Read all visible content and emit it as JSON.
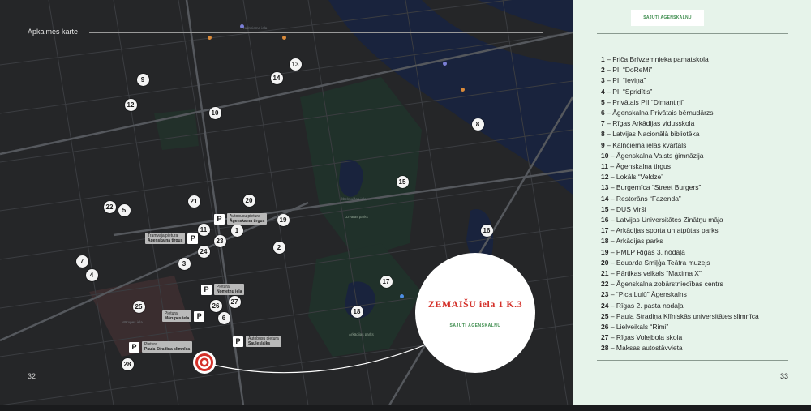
{
  "header": {
    "title": "Apkaimes karte",
    "page_left": "32",
    "page_right": "33"
  },
  "brand": "SAJŪTI ĀGENSKALNU",
  "callout": {
    "title": "ZEMAIŠU iela 1 K.3",
    "brand": "SAJŪTI ĀGENSKALNU"
  },
  "colors": {
    "accent_red": "#d4312a",
    "brand_green": "#3e8d4e",
    "panel_bg": "#e6f3ea",
    "map_bg": "#252628",
    "water": "#19233d",
    "park": "#20312a"
  },
  "map_markers": [
    {
      "num": "1"
    },
    {
      "num": "2"
    },
    {
      "num": "3"
    },
    {
      "num": "4"
    },
    {
      "num": "5"
    },
    {
      "num": "6"
    },
    {
      "num": "7"
    },
    {
      "num": "8"
    },
    {
      "num": "9"
    },
    {
      "num": "10"
    },
    {
      "num": "11"
    },
    {
      "num": "12"
    },
    {
      "num": "13"
    },
    {
      "num": "14"
    },
    {
      "num": "15"
    },
    {
      "num": "16"
    },
    {
      "num": "17"
    },
    {
      "num": "18"
    },
    {
      "num": "19"
    },
    {
      "num": "20"
    },
    {
      "num": "21"
    },
    {
      "num": "22"
    },
    {
      "num": "23"
    },
    {
      "num": "24"
    },
    {
      "num": "25"
    },
    {
      "num": "26"
    },
    {
      "num": "27"
    },
    {
      "num": "28"
    }
  ],
  "parking": [
    {
      "badge": "P",
      "line1": "Autobusu pietura",
      "line2": "Āgenskalna tirgus"
    },
    {
      "badge": "P",
      "line1": "Tramvaja pietura",
      "line2": "Āgenskalna tirgus"
    },
    {
      "badge": "P",
      "line1": "Pietura",
      "line2": "Nometņu iela"
    },
    {
      "badge": "P",
      "line1": "Pietura",
      "line2": "Mārupes iela"
    },
    {
      "badge": "P",
      "line1": "Autobusu pietura",
      "line2": "Sauleslaiks"
    },
    {
      "badge": "P",
      "line1": "Pietura",
      "line2": "Paula Stradiņa slimnīca"
    }
  ],
  "map_labels": {
    "street1": "Kalnciema iela",
    "street2": "Mārupes iela",
    "street3": "Ēbelmuižas iela",
    "park": "Arkādijas parks",
    "park2": "Uzvaras parks"
  },
  "legend": [
    {
      "num": "1",
      "text": "Friča Brīvzemnieka pamatskola"
    },
    {
      "num": "2",
      "text": "PII “DoReMi”"
    },
    {
      "num": "3",
      "text": "PII “Ieviņa”"
    },
    {
      "num": "4",
      "text": "PII “Spridītis”"
    },
    {
      "num": "5",
      "text": "Privātais PII “Dimantiņi”"
    },
    {
      "num": "6",
      "text": "Āgenskalna Privātais bērnudārzs"
    },
    {
      "num": "7",
      "text": "Rīgas Arkādijas vidusskola"
    },
    {
      "num": "8",
      "text": "Latvijas Nacionālā bibliotēka"
    },
    {
      "num": "9",
      "text": "Kalnciema ielas kvartāls"
    },
    {
      "num": "10",
      "text": "Āgenskalna Valsts ģimnāzija"
    },
    {
      "num": "11",
      "text": "Āgenskalna tirgus"
    },
    {
      "num": "12",
      "text": "Lokāls “Veldze”"
    },
    {
      "num": "13",
      "text": "Burgernīca “Street Burgers”"
    },
    {
      "num": "14",
      "text": "Restorāns “Fazenda”"
    },
    {
      "num": "15",
      "text": "DUS Virši"
    },
    {
      "num": "16",
      "text": "Latvijas Universitātes Zinātņu māja"
    },
    {
      "num": "17",
      "text": "Arkādijas sporta un atpūtas parks"
    },
    {
      "num": "18",
      "text": "Arkādijas parks"
    },
    {
      "num": "19",
      "text": "PMLP Rīgas 3. nodaļa"
    },
    {
      "num": "20",
      "text": "Eduarda Smiļģa Teātra muzejs"
    },
    {
      "num": "21",
      "text": "Pārtikas veikals “Maxima X”"
    },
    {
      "num": "22",
      "text": "Āgenskalna zobārstniecības centrs"
    },
    {
      "num": "23",
      "text": "“Pica Lulū” Āgenskalns"
    },
    {
      "num": "24",
      "text": "Rīgas 2. pasta nodaļa"
    },
    {
      "num": "25",
      "text": "Paula Stradiņa Klīniskās universitātes slimnīca"
    },
    {
      "num": "26",
      "text": "Lielveikals “Rimi”"
    },
    {
      "num": "27",
      "text": "Rīgas Volejbola skola"
    },
    {
      "num": "28",
      "text": "Maksas autostāvvieta"
    }
  ]
}
